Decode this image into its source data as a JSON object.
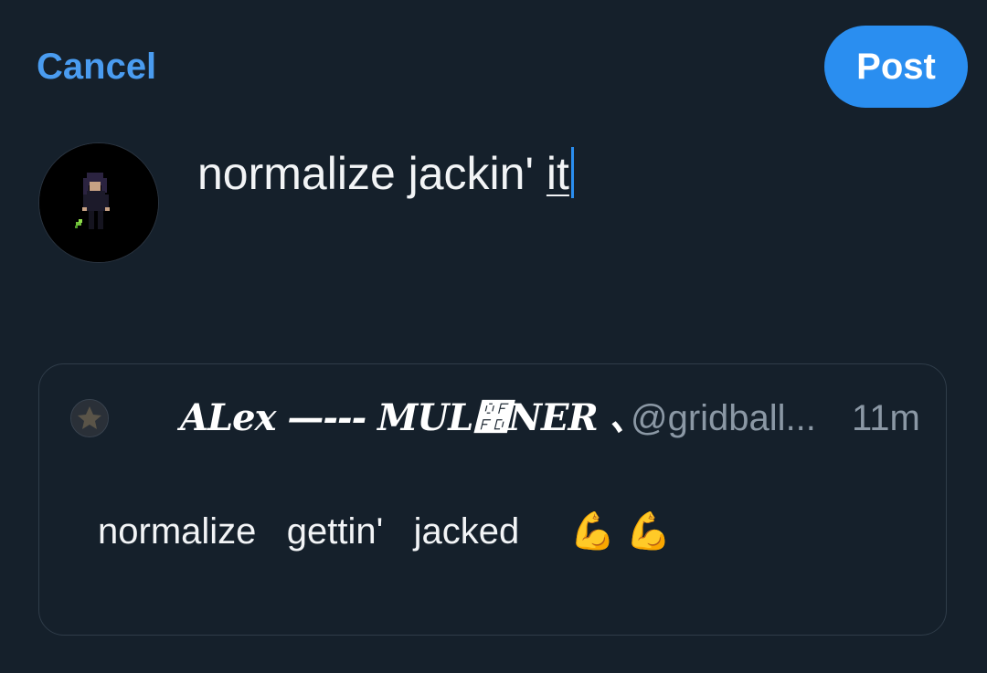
{
  "header": {
    "cancel_label": "Cancel",
    "post_label": "Post"
  },
  "compose": {
    "text_before": "normalize jackin' ",
    "text_last_word": "it"
  },
  "quoted_post": {
    "display_name": "ALex —--- MUL࿽NER 、",
    "handle": "@gridball...",
    "time": "11m",
    "text": "normalize   gettin'   jacked     ",
    "emoji": "💪 💪"
  },
  "colors": {
    "background": "#15202b",
    "accent": "#2a8ef0",
    "link": "#4a9cf0",
    "secondary_text": "#8b98a5",
    "border": "#2f3c49"
  }
}
